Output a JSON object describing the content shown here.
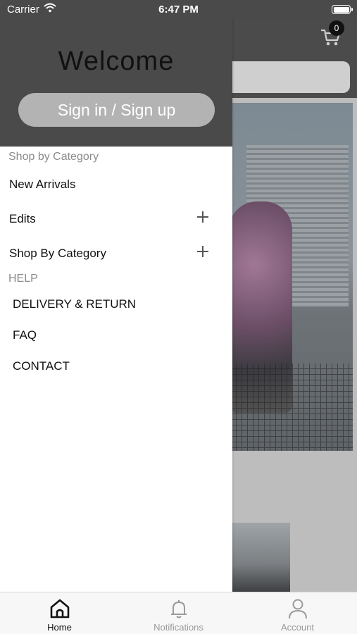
{
  "status_bar": {
    "carrier": "Carrier",
    "time": "6:47 PM"
  },
  "header": {
    "cart_count": "0"
  },
  "drawer": {
    "welcome": "Welcome",
    "signin_label": "Sign in / Sign up",
    "shop_section_label": "Shop by Category",
    "items": [
      {
        "label": "New Arrivals",
        "expandable": false
      },
      {
        "label": "Edits",
        "expandable": true
      },
      {
        "label": "Shop By Category",
        "expandable": true
      }
    ],
    "help_section_label": "HELP",
    "help_items": [
      {
        "label": "DELIVERY & RETURN"
      },
      {
        "label": "FAQ"
      },
      {
        "label": "CONTACT"
      }
    ]
  },
  "tab_bar": {
    "tabs": [
      {
        "label": "Home",
        "icon": "home-icon",
        "active": true
      },
      {
        "label": "Notifications",
        "icon": "bell-icon",
        "active": false
      },
      {
        "label": "Account",
        "icon": "person-icon",
        "active": false
      }
    ]
  },
  "colors": {
    "header_bg": "#4a4a4a",
    "signin_bg": "#b3b3b3",
    "muted_text": "#8a8a8a"
  }
}
